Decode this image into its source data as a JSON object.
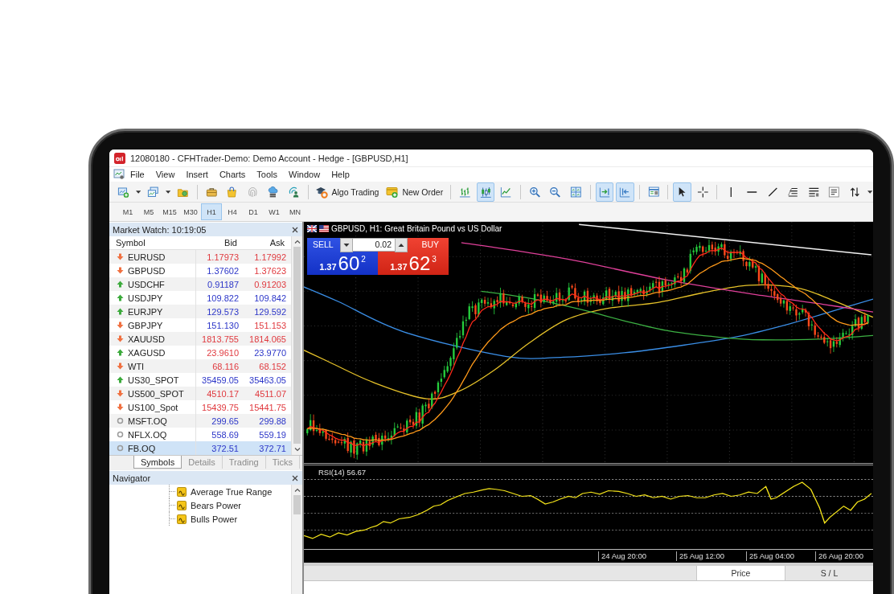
{
  "window": {
    "title": "12080180 - CFHTrader-Demo: Demo Account - Hedge - [GBPUSD,H1]"
  },
  "menu": [
    "File",
    "View",
    "Insert",
    "Charts",
    "Tools",
    "Window",
    "Help"
  ],
  "toolbar": {
    "buttons": [
      {
        "label": "Algo Trading"
      },
      {
        "label": "New Order"
      }
    ],
    "chart_types": [
      {
        "selected": false
      },
      {
        "selected": true
      },
      {
        "selected": false
      }
    ],
    "chart_options": [
      {
        "on": true
      },
      {
        "on": true
      }
    ],
    "pointer_tools": [
      {
        "selected": true
      },
      {
        "selected": false
      }
    ]
  },
  "timeframes": [
    {
      "label": "M1",
      "selected": false
    },
    {
      "label": "M5",
      "selected": false
    },
    {
      "label": "M15",
      "selected": false
    },
    {
      "label": "M30",
      "selected": false
    },
    {
      "label": "H1",
      "selected": true
    },
    {
      "label": "H4",
      "selected": false
    },
    {
      "label": "D1",
      "selected": false
    },
    {
      "label": "W1",
      "selected": false
    },
    {
      "label": "MN",
      "selected": false
    }
  ],
  "market_watch": {
    "title": "Market Watch: 10:19:05",
    "columns": [
      "Symbol",
      "Bid",
      "Ask"
    ],
    "rows": [
      {
        "symbol": "EURUSD",
        "kind": "down",
        "bid": {
          "value": "1.17973",
          "color": "#e0393e"
        },
        "ask": {
          "value": "1.17992",
          "color": "#e0393e"
        },
        "selected": false
      },
      {
        "symbol": "GBPUSD",
        "kind": "down",
        "bid": {
          "value": "1.37602",
          "color": "#2b35c8"
        },
        "ask": {
          "value": "1.37623",
          "color": "#e0393e"
        },
        "selected": false
      },
      {
        "symbol": "USDCHF",
        "kind": "up",
        "bid": {
          "value": "0.91187",
          "color": "#2b35c8"
        },
        "ask": {
          "value": "0.91203",
          "color": "#e0393e"
        },
        "selected": false
      },
      {
        "symbol": "USDJPY",
        "kind": "up",
        "bid": {
          "value": "109.822",
          "color": "#2b35c8"
        },
        "ask": {
          "value": "109.842",
          "color": "#2b35c8"
        },
        "selected": false
      },
      {
        "symbol": "EURJPY",
        "kind": "up",
        "bid": {
          "value": "129.573",
          "color": "#2b35c8"
        },
        "ask": {
          "value": "129.592",
          "color": "#2b35c8"
        },
        "selected": false
      },
      {
        "symbol": "GBPJPY",
        "kind": "down",
        "bid": {
          "value": "151.130",
          "color": "#2b35c8"
        },
        "ask": {
          "value": "151.153",
          "color": "#e0393e"
        },
        "selected": false
      },
      {
        "symbol": "XAUUSD",
        "kind": "down",
        "bid": {
          "value": "1813.755",
          "color": "#e0393e"
        },
        "ask": {
          "value": "1814.065",
          "color": "#e0393e"
        },
        "selected": false
      },
      {
        "symbol": "XAGUSD",
        "kind": "up",
        "bid": {
          "value": "23.9610",
          "color": "#e0393e"
        },
        "ask": {
          "value": "23.9770",
          "color": "#2b35c8"
        },
        "selected": false
      },
      {
        "symbol": "WTI",
        "kind": "down",
        "bid": {
          "value": "68.116",
          "color": "#e0393e"
        },
        "ask": {
          "value": "68.152",
          "color": "#e0393e"
        },
        "selected": false
      },
      {
        "symbol": "US30_SPOT",
        "kind": "up",
        "bid": {
          "value": "35459.05",
          "color": "#2b35c8"
        },
        "ask": {
          "value": "35463.05",
          "color": "#2b35c8"
        },
        "selected": false
      },
      {
        "symbol": "US500_SPOT",
        "kind": "down",
        "bid": {
          "value": "4510.17",
          "color": "#e0393e"
        },
        "ask": {
          "value": "4511.07",
          "color": "#e0393e"
        },
        "selected": false
      },
      {
        "symbol": "US100_Spot",
        "kind": "down",
        "bid": {
          "value": "15439.75",
          "color": "#e0393e"
        },
        "ask": {
          "value": "15441.75",
          "color": "#e0393e"
        },
        "selected": false
      },
      {
        "symbol": "MSFT.OQ",
        "kind": "none",
        "bid": {
          "value": "299.65",
          "color": "#2b35c8"
        },
        "ask": {
          "value": "299.88",
          "color": "#2b35c8"
        },
        "selected": false
      },
      {
        "symbol": "NFLX.OQ",
        "kind": "none",
        "bid": {
          "value": "558.69",
          "color": "#2b35c8"
        },
        "ask": {
          "value": "559.19",
          "color": "#2b35c8"
        },
        "selected": false
      },
      {
        "symbol": "FB.OQ",
        "kind": "none",
        "bid": {
          "value": "372.51",
          "color": "#2b35c8"
        },
        "ask": {
          "value": "372.71",
          "color": "#2b35c8"
        },
        "selected": true
      }
    ]
  },
  "panel_tabs": [
    {
      "label": "Symbols",
      "selected": true
    },
    {
      "label": "Details",
      "selected": false
    },
    {
      "label": "Trading",
      "selected": false
    },
    {
      "label": "Ticks",
      "selected": false
    }
  ],
  "navigator": {
    "title": "Navigator",
    "items": [
      "Average True Range",
      "Bears Power",
      "Bulls Power"
    ]
  },
  "chart": {
    "title": "GBPUSD, H1: Great Britain Pound vs US Dollar",
    "trade_panel": {
      "sell": {
        "label": "SELL",
        "prefix": "1.37",
        "digits": "60",
        "point": "2"
      },
      "lot": "0.02",
      "buy": {
        "label": "BUY",
        "prefix": "1.37",
        "digits": "62",
        "point": "3"
      }
    },
    "indicator": "RSI(14) 56.67",
    "time_labels": [
      "24 Aug 20:00",
      "25 Aug 12:00",
      "25 Aug 04:00",
      "26 Aug 20:00"
    ]
  },
  "terminal": {
    "columns": [
      "Price",
      "S / L"
    ]
  }
}
